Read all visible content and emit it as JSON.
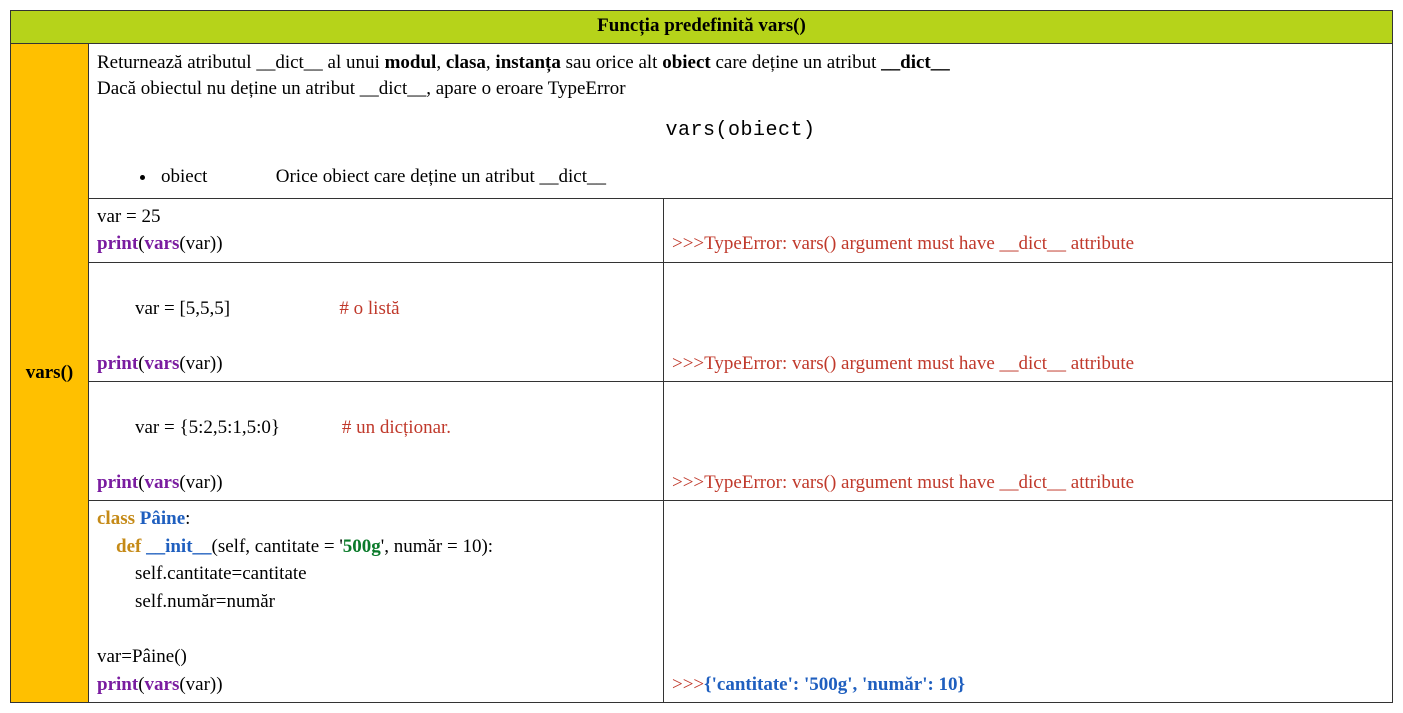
{
  "header": {
    "title": "Funcția predefinită vars()"
  },
  "side": {
    "label": "vars()"
  },
  "desc": {
    "line1_a": "Returnează atributul __dict__ al unui ",
    "w_modul": "modul",
    "sep1": ", ",
    "w_clasa": "clasa",
    "sep2": ", ",
    "w_instanta": "instanța",
    "mid": " sau orice alt ",
    "w_obiect": "obiect",
    "after_obiect": " care deține un atribut ",
    "w_dict": "__dict__",
    "line2": "Dacă obiectul nu deține un atribut __dict__, apare o eroare TypeError",
    "signature": "vars(obiect)",
    "param_name": "obiect",
    "param_desc": "Orice obiect care deține un atribut __dict__"
  },
  "ex1": {
    "l1": "var = 25",
    "p_open": "print",
    "f": "vars",
    "arg": "(var))",
    "out_prompt": ">>>",
    "out": "TypeError: vars() argument must have __dict__ attribute"
  },
  "ex2": {
    "l1a": "var = [5,5,5]",
    "l1pad": "                       ",
    "l1c": "# o listă",
    "p_open": "print",
    "f": "vars",
    "arg": "(var))",
    "out_prompt": ">>>",
    "out": "TypeError: vars() argument must have __dict__ attribute"
  },
  "ex3": {
    "l1a": "var = {5:2,5:1,5:0}",
    "l1pad": "             ",
    "l1c": "# un dicționar.",
    "p_open": "print",
    "f": "vars",
    "arg": "(var))",
    "out_prompt": ">>>",
    "out": "TypeError: vars() argument must have __dict__ attribute"
  },
  "ex4": {
    "kw_class": "class ",
    "cls": "Pâine",
    "colon": ":",
    "indent1": "    ",
    "kw_def": "def ",
    "dunder": "__init__",
    "params_a": "(self, cantitate = '",
    "strlit": "500g",
    "params_b": "', număr = 10):",
    "indent2": "        ",
    "body1": "self.cantitate=cantitate",
    "body2": "self.număr=număr",
    "assign": "var=Pâine()",
    "p_open": "print",
    "f": "vars",
    "arg": "(var))",
    "out_prompt": ">>>",
    "out": "{'cantitate': '500g', 'număr': 10}"
  }
}
